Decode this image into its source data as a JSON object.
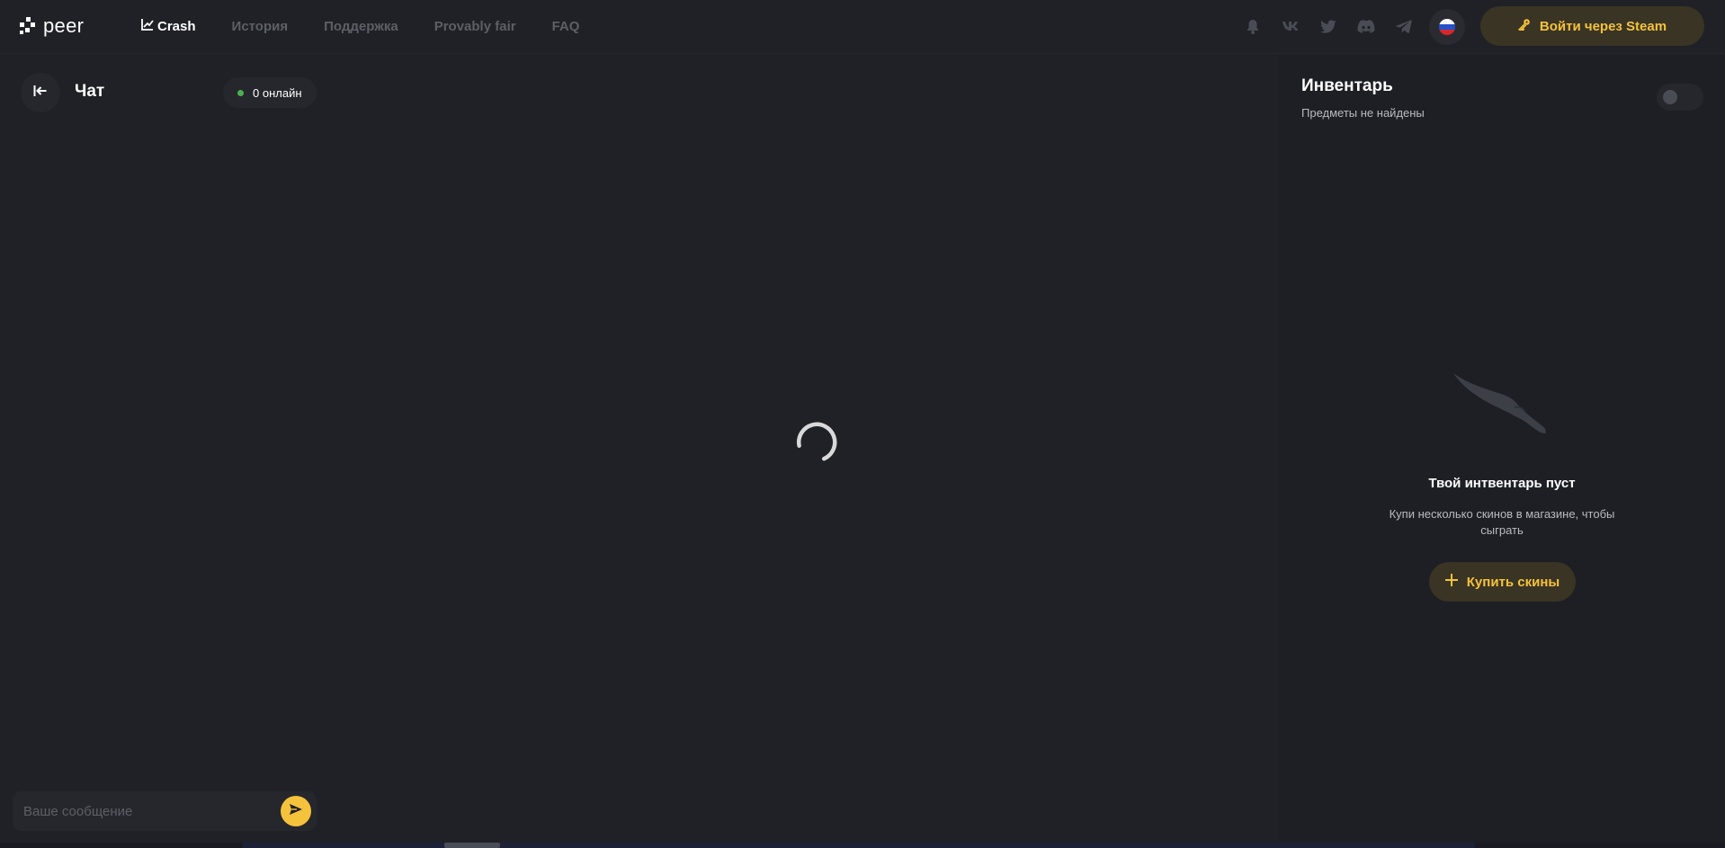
{
  "header": {
    "logo_text": "peer",
    "nav": [
      {
        "label": "Crash",
        "active": true,
        "icon": "chart-line-icon"
      },
      {
        "label": "История",
        "active": false
      },
      {
        "label": "Поддержка",
        "active": false
      },
      {
        "label": "Provably fair",
        "active": false
      },
      {
        "label": "FAQ",
        "active": false
      }
    ],
    "social_icons": [
      "bell-icon",
      "vk-icon",
      "twitter-icon",
      "discord-icon",
      "telegram-icon"
    ],
    "language_flag": "russian-flag-icon",
    "login_button": "Войти через Steam",
    "login_icon": "key-icon"
  },
  "chat": {
    "title": "Чат",
    "online_label": "0 онлайн",
    "input_placeholder": "Ваше сообщение",
    "input_value": ""
  },
  "main": {
    "state": "loading"
  },
  "inventory": {
    "title": "Инвентарь",
    "subtitle": "Предметы не найдены",
    "toggle_on": false,
    "empty_title": "Твой интвентарь пуст",
    "empty_text": "Купи несколько скинов в магазине, чтобы сыграть",
    "buy_button": "Купить скины"
  },
  "colors": {
    "background": "#202126",
    "accent": "#f5c23c",
    "accent_bg": "#3a3424",
    "muted_text": "#5d5f66",
    "online": "#4caf50"
  }
}
